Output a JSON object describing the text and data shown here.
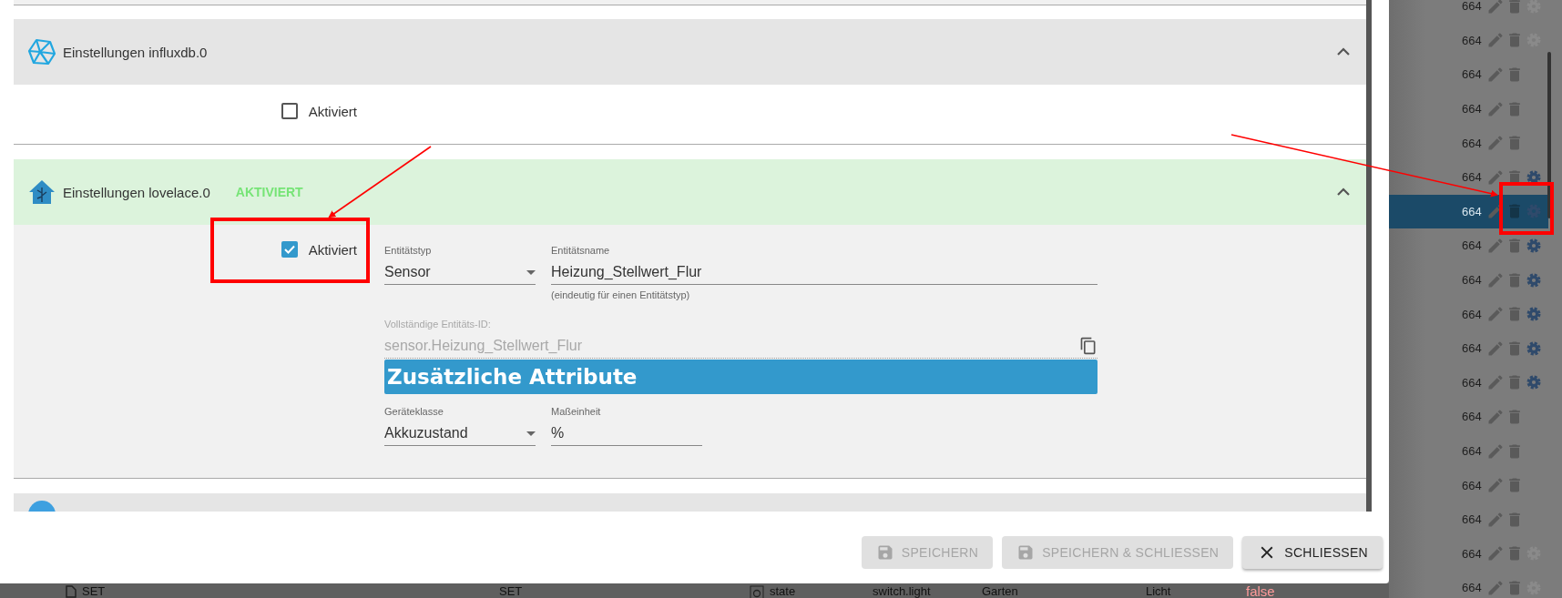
{
  "dialog": {
    "panels": [
      {
        "title": "Einstellungen influxdb.0",
        "expanded": true,
        "enabled": false,
        "checkbox": {
          "label": "Aktiviert",
          "checked": false
        }
      },
      {
        "title": "Einstellungen lovelace.0",
        "status_badge": "AKTIVIERT",
        "expanded": true,
        "enabled": true,
        "checkbox": {
          "label": "Aktiviert",
          "checked": true
        },
        "form": {
          "entity_type": {
            "label": "Entitätstyp",
            "value": "Sensor"
          },
          "entity_name": {
            "label": "Entitätsname",
            "value": "Heizung_Stellwert_Flur",
            "helper": "(eindeutig für einen Entitätstyp)"
          },
          "full_id": {
            "label": "Vollständige Entitäts-ID:",
            "value": "sensor.Heizung_Stellwert_Flur"
          },
          "section_title": "Zusätzliche Attribute",
          "device_class": {
            "label": "Geräteklasse",
            "value": "Akkuzustand"
          },
          "unit": {
            "label": "Maßeinheit",
            "value": "%"
          }
        }
      },
      {
        "enabled": false
      }
    ],
    "buttons": [
      {
        "label": "SPEICHERN",
        "kind": "save",
        "disabled": true
      },
      {
        "label": "SPEICHERN & SCHLIESSEN",
        "kind": "save",
        "disabled": true
      },
      {
        "label": "SCHLIESSEN",
        "kind": "close",
        "disabled": false
      }
    ]
  },
  "background_list": {
    "rows": [
      {
        "value": "664",
        "has_settings": true,
        "settings_enabled": false,
        "selected": false
      },
      {
        "value": "664",
        "has_settings": true,
        "settings_enabled": false,
        "selected": false
      },
      {
        "value": "664",
        "has_settings": false,
        "selected": false
      },
      {
        "value": "664",
        "has_settings": false,
        "selected": false
      },
      {
        "value": "664",
        "has_settings": false,
        "selected": false
      },
      {
        "value": "664",
        "has_settings": true,
        "settings_enabled": true,
        "selected": false
      },
      {
        "value": "664",
        "has_settings": true,
        "settings_enabled": true,
        "selected": true
      },
      {
        "value": "664",
        "has_settings": true,
        "settings_enabled": true,
        "selected": false
      },
      {
        "value": "664",
        "has_settings": true,
        "settings_enabled": true,
        "selected": false
      },
      {
        "value": "664",
        "has_settings": true,
        "settings_enabled": true,
        "selected": false
      },
      {
        "value": "664",
        "has_settings": true,
        "settings_enabled": true,
        "selected": false
      },
      {
        "value": "664",
        "has_settings": true,
        "settings_enabled": true,
        "selected": false
      },
      {
        "value": "664",
        "has_settings": false,
        "selected": false
      },
      {
        "value": "664",
        "has_settings": false,
        "selected": false
      },
      {
        "value": "664",
        "has_settings": false,
        "selected": false
      },
      {
        "value": "664",
        "has_settings": false,
        "selected": false
      },
      {
        "value": "664",
        "has_settings": true,
        "settings_enabled": false,
        "selected": false
      },
      {
        "value": "664",
        "has_settings": true,
        "settings_enabled": false,
        "selected": false
      }
    ]
  },
  "background_table_row": {
    "cells": [
      {
        "kind": "name",
        "text": "SET"
      },
      {
        "kind": "text",
        "text": "SET"
      },
      {
        "kind": "role",
        "text": "state"
      },
      {
        "kind": "strong",
        "text": "switch.light"
      },
      {
        "kind": "text",
        "text": "Garten"
      },
      {
        "kind": "text",
        "text": "Licht"
      },
      {
        "kind": "value",
        "text": "false"
      }
    ]
  }
}
